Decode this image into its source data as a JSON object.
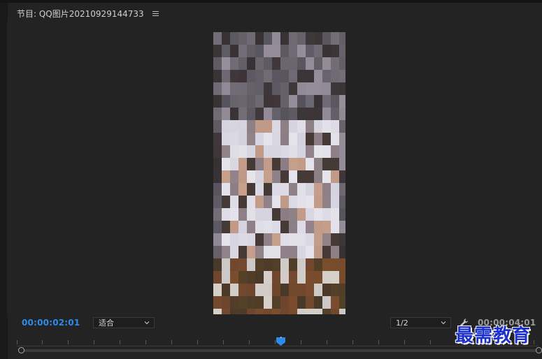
{
  "panel": {
    "title": "节目: QQ图片20210929144733"
  },
  "transport": {
    "current_timecode": "00:00:02:01",
    "duration_timecode": "00:00:04:01",
    "zoom_select": {
      "value": "适合"
    },
    "resolution_select": {
      "value": "1/2"
    }
  },
  "icons": {
    "menu": "hamburger-menu-icon",
    "wrench": "wrench-icon",
    "chevron": "chevron-down-icon",
    "playhead": "playhead-marker-icon"
  },
  "colors": {
    "timecode_active": "#2d8ceb",
    "playhead": "#2d8ceb",
    "watermark": "#1c30d0"
  },
  "watermark": {
    "text": "最需教育"
  }
}
